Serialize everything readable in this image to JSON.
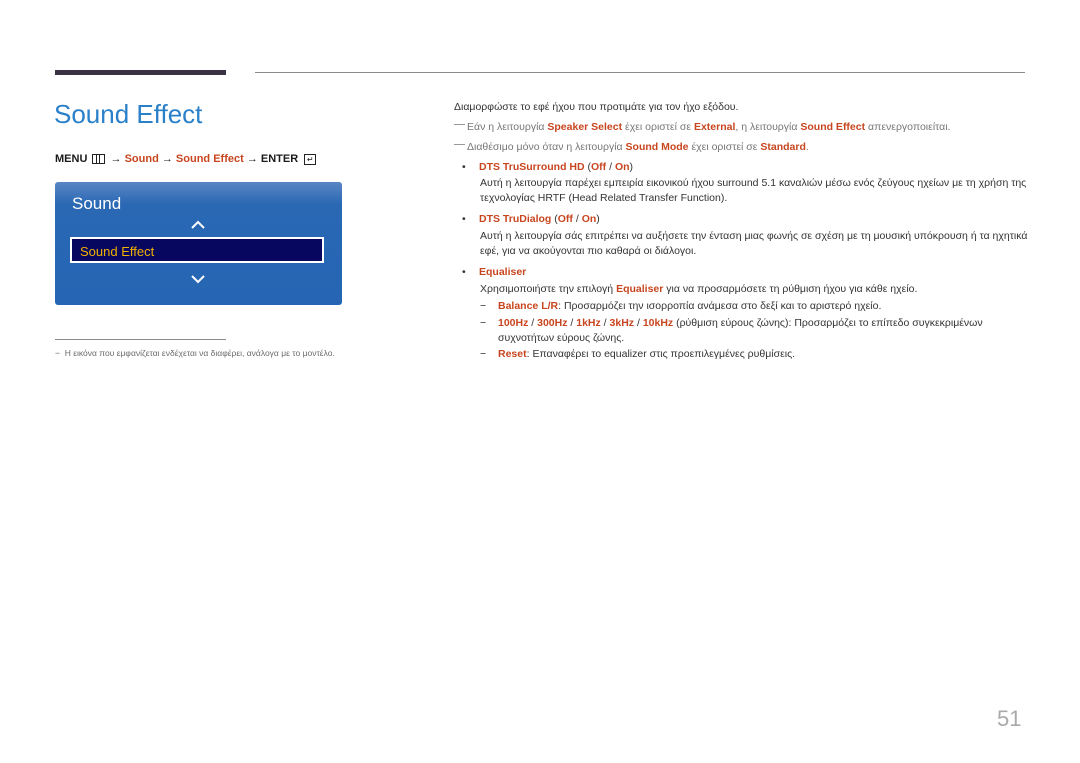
{
  "page": {
    "title": "Sound Effect",
    "page_number": "51"
  },
  "menu_path": {
    "menu": "MENU",
    "arrow": "→",
    "step1": "Sound",
    "step2": "Sound Effect",
    "enter": "ENTER",
    "menu_icon": "menu-grid-icon",
    "enter_icon": "enter-return-icon"
  },
  "osd_panel": {
    "title": "Sound",
    "selected_item": "Sound Effect",
    "up_icon": "chevron-up-icon",
    "down_icon": "chevron-down-icon",
    "colors": {
      "panel": "#2565b3",
      "selected_bg": "#08075f",
      "selected_text": "#f2b100"
    }
  },
  "footnote": "Η εικόνα που εμφανίζεται ενδέχεται να διαφέρει, ανάλογα με το μοντέλο.",
  "content": {
    "intro": "Διαμορφώστε το εφέ ήχου που προτιμάτε για τον ήχο εξόδου.",
    "note1": {
      "a": "Εάν η λειτουργία ",
      "b": "Speaker Select",
      "c": " έχει οριστεί σε ",
      "d": "External",
      "e": ", η λειτουργία ",
      "f": "Sound Effect",
      "g": " απενεργοποιείται."
    },
    "note2": {
      "a": "Διαθέσιμο μόνο όταν η λειτουργία ",
      "b": "Sound Mode",
      "c": " έχει οριστεί σε ",
      "d": "Standard",
      "e": "."
    },
    "items": [
      {
        "name": "DTS TruSurround HD",
        "off": "Off",
        "on": "On",
        "description": "Αυτή η λειτουργία παρέχει εμπειρία εικονικού ήχου surround 5.1 καναλιών μέσω ενός ζεύγους ηχείων με τη χρήση της τεχνολογίας HRTF (Head Related Transfer Function)."
      },
      {
        "name": "DTS TruDialog",
        "off": "Off",
        "on": "On",
        "description": "Αυτή η λειτουργία σάς επιτρέπει να αυξήσετε την ένταση μιας φωνής σε σχέση με τη μουσική υπόκρουση ή τα ηχητικά εφέ, για να ακούγονται πιο καθαρά οι διάλογοι."
      },
      {
        "name": "Equaliser",
        "description_a": "Χρησιμοποιήστε την επιλογή ",
        "description_b": "Equaliser",
        "description_c": " για να προσαρμόσετε τη ρύθμιση ήχου για κάθε ηχείο.",
        "subitems": [
          {
            "name": "Balance L/R",
            "text": ": Προσαρμόζει την ισορροπία ανάμεσα στο δεξί και το αριστερό ηχείο."
          },
          {
            "freqs": [
              "100Hz",
              "300Hz",
              "1kHz",
              "3kHz",
              "10kHz"
            ],
            "text_line1": " (ρύθμιση εύρους ζώνης): Προσαρμόζει το επίπεδο συγκεκριμένων",
            "text_line2": "συχνοτήτων εύρους ζώνης."
          },
          {
            "name": "Reset",
            "text": ": Επαναφέρει το equalizer στις προεπιλεγμένες ρυθμίσεις."
          }
        ]
      }
    ]
  }
}
